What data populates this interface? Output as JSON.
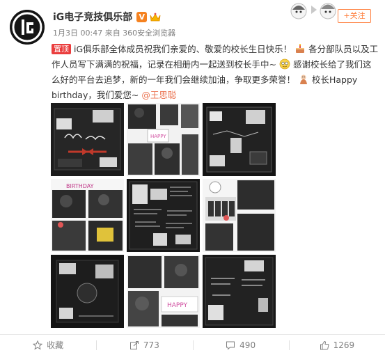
{
  "author": {
    "name": "iG电子竞技俱乐部",
    "verified_badge": "V",
    "meta": "1月3日 00:47 来自 360安全浏览器"
  },
  "follow_label": "+关注",
  "post": {
    "pin_label": "置顶",
    "text_part1": "iG俱乐部全体成员祝我们亲爱的、敬爱的校长生日快乐！",
    "text_part2": "各分部队员以及工作人员写下满满的祝福，记录在相册内一起送到校长手中~",
    "text_part3": "感谢校长给了我们这么好的平台去追梦，新的一年我们会继续加油，争取更多荣誉！",
    "text_part4": "校长Happy birthday，我们爱您~",
    "mention": "@王思聪"
  },
  "gallery": {
    "count": 9,
    "images": [
      {
        "name": "photo-1",
        "scene": "dark-board-happy-birthday"
      },
      {
        "name": "photo-2",
        "scene": "collage-writing"
      },
      {
        "name": "photo-3",
        "scene": "dark-album-page"
      },
      {
        "name": "photo-4",
        "scene": "collage-birthday-stickers"
      },
      {
        "name": "photo-5",
        "scene": "chalk-board-notes"
      },
      {
        "name": "photo-6",
        "scene": "team-photo-collage"
      },
      {
        "name": "photo-7",
        "scene": "dark-album-frame"
      },
      {
        "name": "photo-8",
        "scene": "collage-happy-stickers"
      },
      {
        "name": "photo-9",
        "scene": "dark-board-writing"
      }
    ]
  },
  "actions": [
    {
      "name": "favorite",
      "icon": "star-icon",
      "label": "收藏"
    },
    {
      "name": "repost",
      "icon": "repost-icon",
      "label": "773"
    },
    {
      "name": "comment",
      "icon": "comment-icon",
      "label": "490"
    },
    {
      "name": "like",
      "icon": "thumb-up-icon",
      "label": "1269"
    }
  ],
  "colors": {
    "accent": "#ff8140",
    "mention": "#eb7350",
    "pin": "#ea3d3d",
    "muted": "#808080"
  }
}
